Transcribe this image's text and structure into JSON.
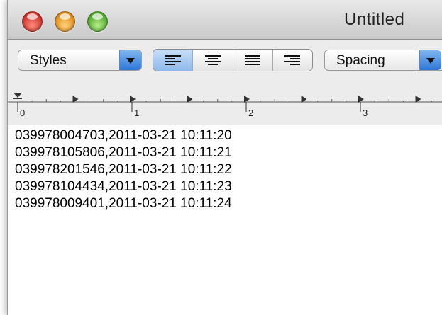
{
  "window": {
    "title": "Untitled"
  },
  "toolbar": {
    "styles_label": "Styles",
    "spacing_label": "Spacing",
    "alignment": [
      "align-left",
      "align-center",
      "align-justify",
      "align-right"
    ]
  },
  "ruler": {
    "numbers": [
      "0",
      "1",
      "2",
      "3"
    ]
  },
  "document": {
    "lines": [
      "039978004703,2011-03-21 10:11:20",
      "039978105806,2011-03-21 10:11:21",
      "039978201546,2011-03-21 10:11:22",
      "039978104434,2011-03-21 10:11:23",
      "039978009401,2011-03-21 10:11:24"
    ]
  },
  "colors": {
    "accent": "#2f76d6",
    "toolbar_bg": "#ececec"
  }
}
